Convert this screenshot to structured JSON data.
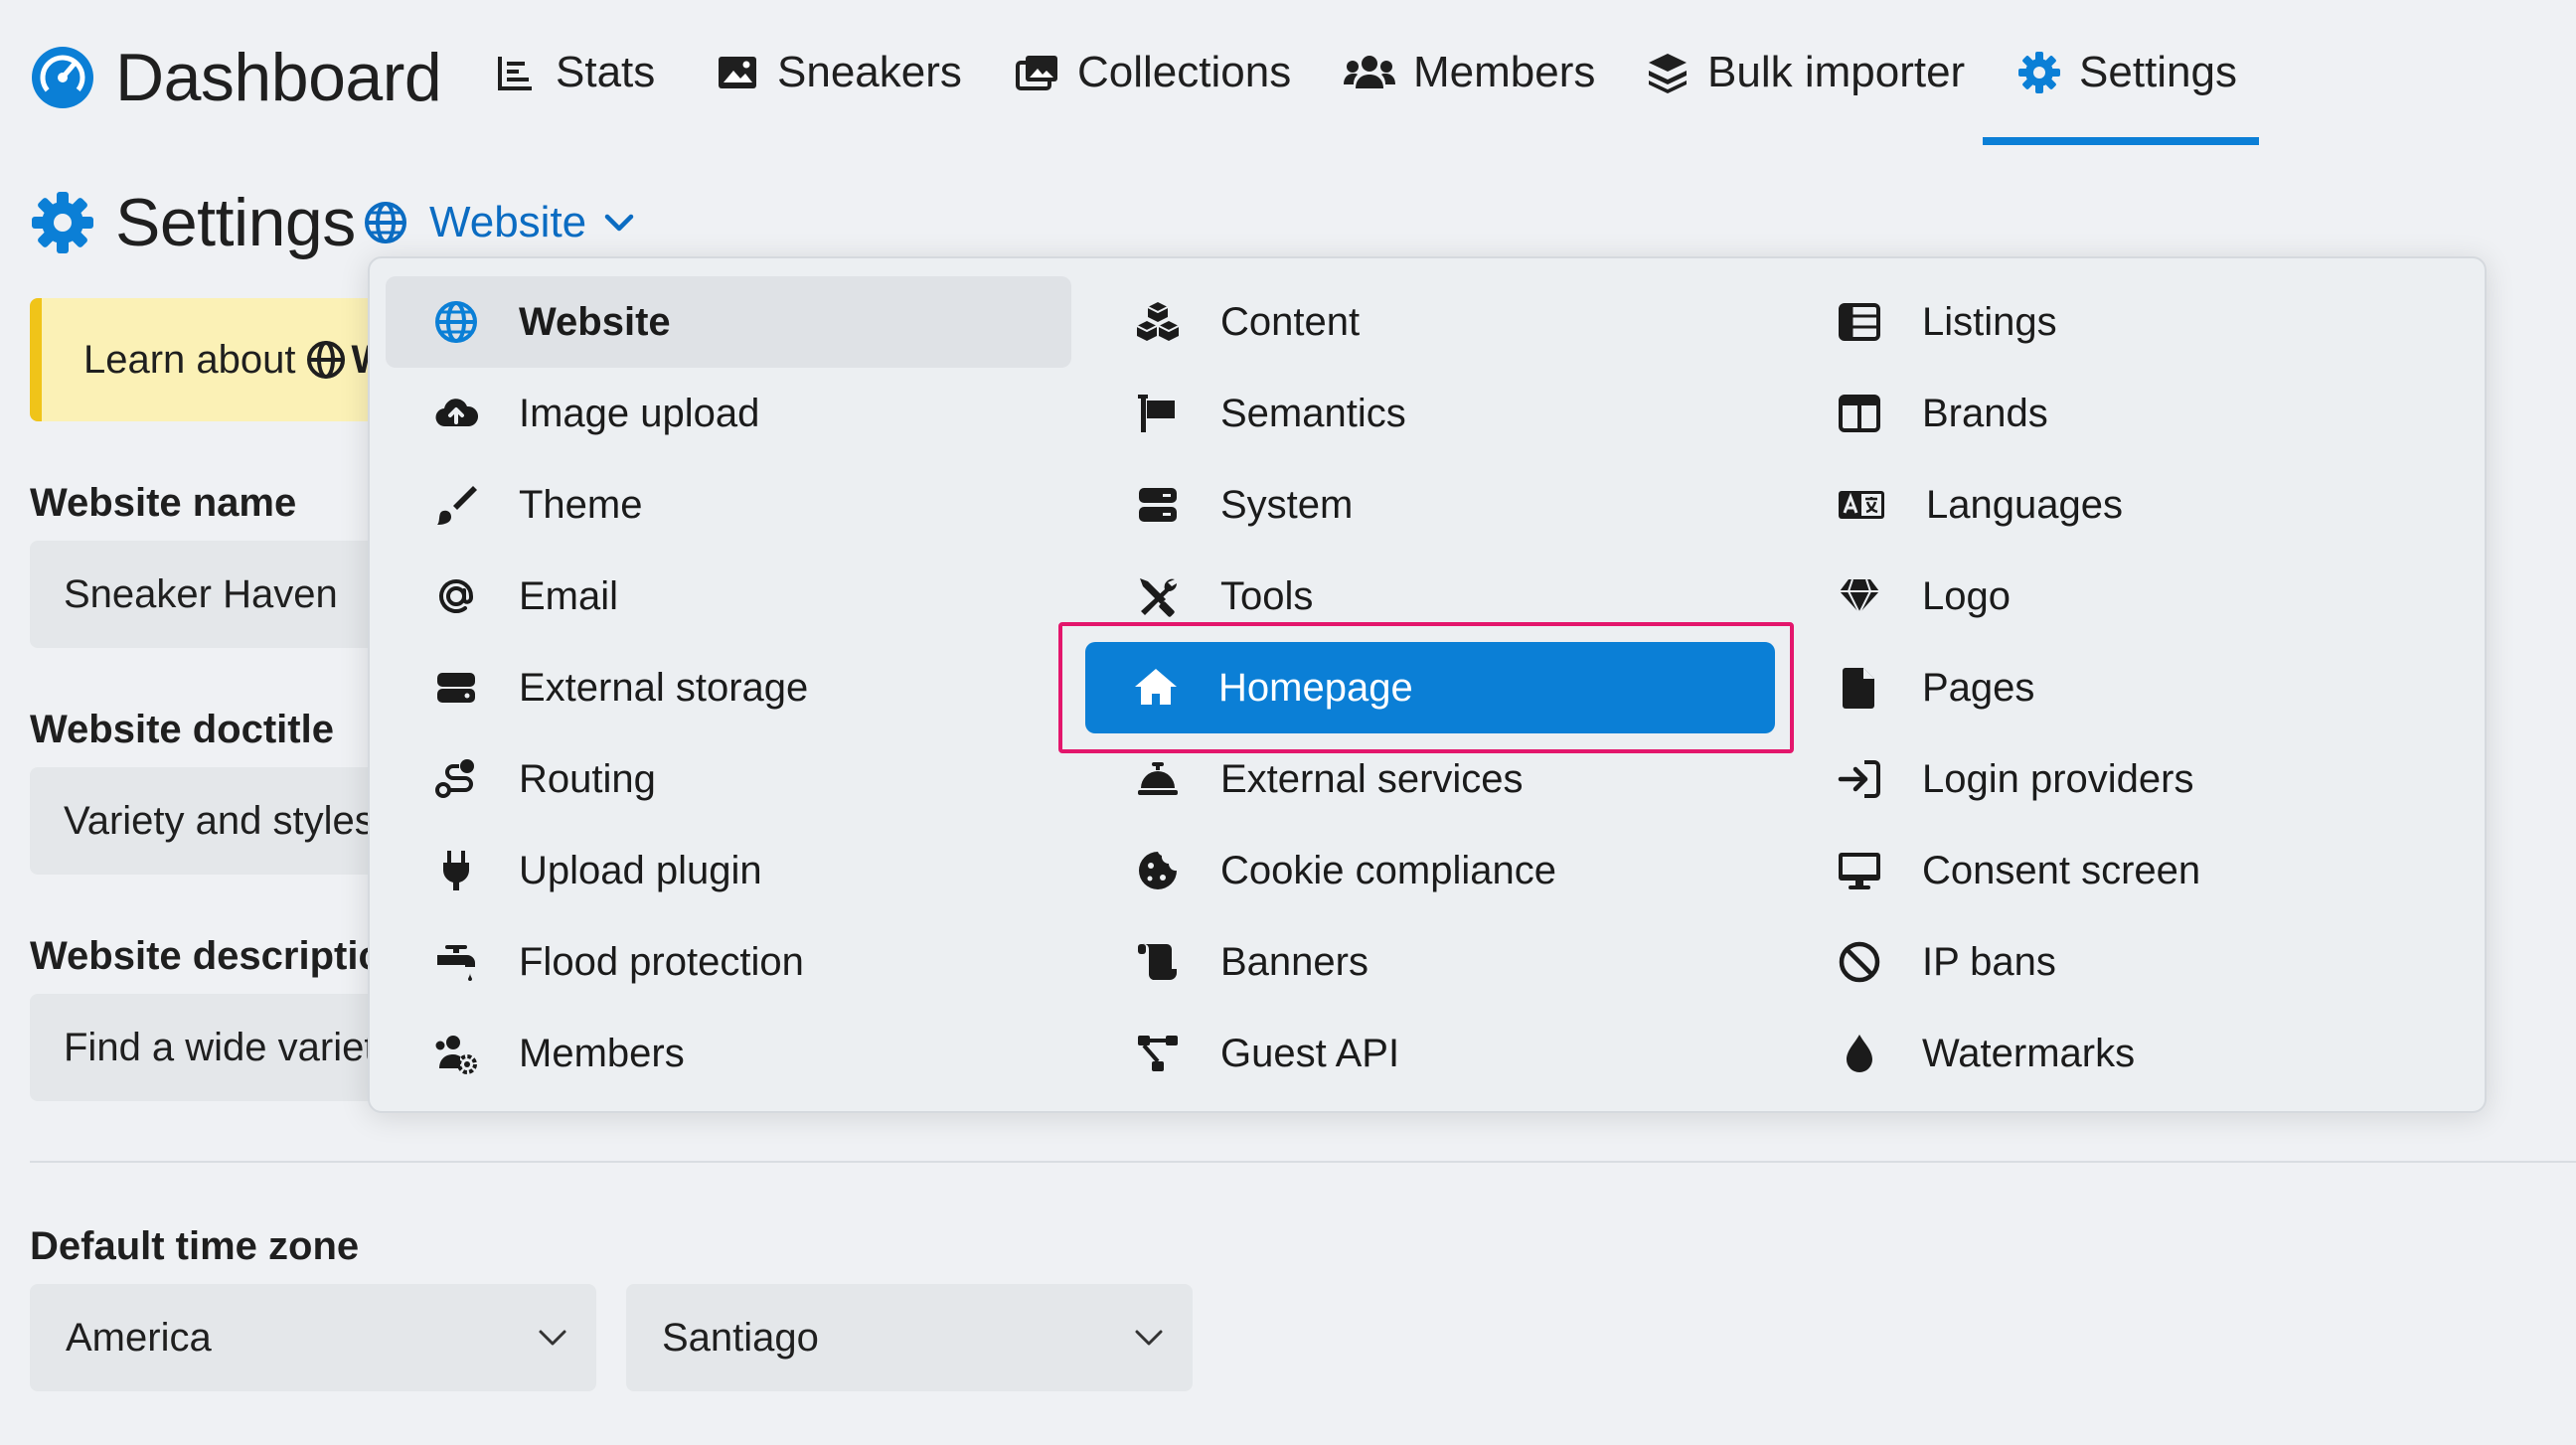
{
  "app": {
    "brand": "Dashboard",
    "accent_color": "#0b7fd6",
    "highlight_color": "#e3166c"
  },
  "nav": {
    "items": [
      {
        "label": "Stats",
        "icon": "stats-icon"
      },
      {
        "label": "Sneakers",
        "icon": "image-icon"
      },
      {
        "label": "Collections",
        "icon": "images-icon"
      },
      {
        "label": "Members",
        "icon": "users-icon"
      },
      {
        "label": "Bulk importer",
        "icon": "layers-icon"
      },
      {
        "label": "Settings",
        "icon": "gear-icon",
        "active": true
      }
    ]
  },
  "page": {
    "title": "Settings",
    "section_selector": "Website"
  },
  "notice": {
    "text": "Learn about",
    "trailing": "W"
  },
  "form": {
    "website_name": {
      "label": "Website name",
      "value": "Sneaker Haven"
    },
    "website_doctitle": {
      "label": "Website doctitle",
      "value": "Variety and styles"
    },
    "website_description": {
      "label": "Website descriptic",
      "value": "Find a wide variet"
    },
    "time_zone": {
      "label": "Default time zone",
      "region": "America",
      "city": "Santiago"
    }
  },
  "menu": {
    "columns": [
      [
        {
          "label": "Website",
          "icon": "globe-icon",
          "state": "current"
        },
        {
          "label": "Image upload",
          "icon": "cloud-upload-icon"
        },
        {
          "label": "Theme",
          "icon": "paintbrush-icon"
        },
        {
          "label": "Email",
          "icon": "at-sign-icon"
        },
        {
          "label": "External storage",
          "icon": "hard-drive-icon"
        },
        {
          "label": "Routing",
          "icon": "route-icon"
        },
        {
          "label": "Upload plugin",
          "icon": "plug-icon"
        },
        {
          "label": "Flood protection",
          "icon": "faucet-icon"
        },
        {
          "label": "Members",
          "icon": "users-gear-icon"
        }
      ],
      [
        {
          "label": "Content",
          "icon": "cubes-icon"
        },
        {
          "label": "Semantics",
          "icon": "flag-icon"
        },
        {
          "label": "System",
          "icon": "server-icon"
        },
        {
          "label": "Tools",
          "icon": "tools-icon"
        },
        {
          "label": "Homepage",
          "icon": "home-icon",
          "state": "active"
        },
        {
          "label": "External services",
          "icon": "bell-concierge-icon"
        },
        {
          "label": "Cookie compliance",
          "icon": "cookie-icon"
        },
        {
          "label": "Banners",
          "icon": "scroll-icon"
        },
        {
          "label": "Guest API",
          "icon": "network-icon"
        }
      ],
      [
        {
          "label": "Listings",
          "icon": "table-list-icon"
        },
        {
          "label": "Brands",
          "icon": "columns-icon"
        },
        {
          "label": "Languages",
          "icon": "language-icon"
        },
        {
          "label": "Logo",
          "icon": "gem-icon"
        },
        {
          "label": "Pages",
          "icon": "file-icon"
        },
        {
          "label": "Login providers",
          "icon": "sign-in-icon"
        },
        {
          "label": "Consent screen",
          "icon": "desktop-icon"
        },
        {
          "label": "IP bans",
          "icon": "ban-icon"
        },
        {
          "label": "Watermarks",
          "icon": "droplet-icon"
        }
      ]
    ]
  }
}
